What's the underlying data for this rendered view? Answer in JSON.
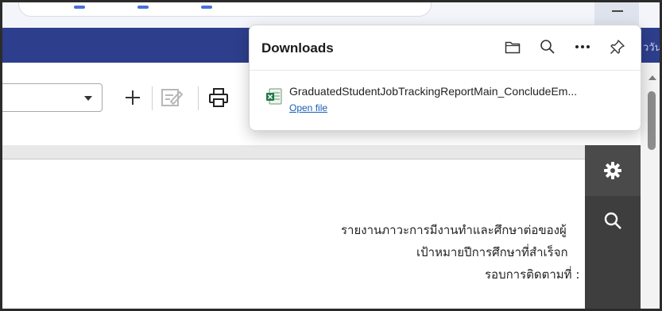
{
  "site_header": {
    "thai_text": "ววัน"
  },
  "downloads_panel": {
    "title": "Downloads",
    "actions": {
      "open_folder": "folder-icon",
      "search": "search-icon",
      "more": "more-icon",
      "pin": "pin-icon"
    },
    "items": [
      {
        "file_name": "GraduatedStudentJobTrackingReportMain_ConcludeEm...",
        "file_type_icon": "excel-file-icon",
        "action_label": "Open file"
      }
    ]
  },
  "report": {
    "lines": [
      "รายงานภาวะการมีงานทำและศึกษาต่อของผู้",
      "เป้าหมายปีการศึกษาที่สำเร็จก",
      "รอบการติดตามที่ :"
    ]
  },
  "colors": {
    "header_navy": "#2d3e8c",
    "side_panel": "#3e3e3e",
    "link_blue": "#1a5fb4",
    "excel_green": "#1e7a44"
  }
}
